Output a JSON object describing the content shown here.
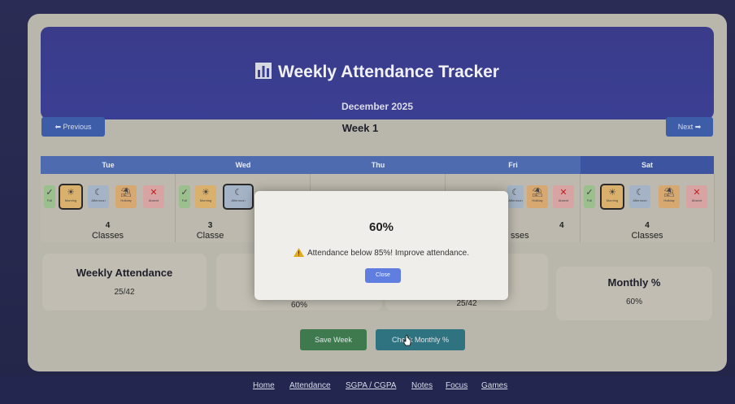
{
  "header": {
    "title": "Weekly Attendance Tracker",
    "month": "December 2025"
  },
  "nav": {
    "previous_label": "⬅ Previous",
    "next_label": "Next ➡",
    "week_label": "Week 1"
  },
  "days": [
    {
      "name": "Tue",
      "classes_count": "4",
      "classes_label": "Classes",
      "selected": "Morning"
    },
    {
      "name": "Wed",
      "classes_count": "3",
      "classes_label": "Classe",
      "selected": "Afternoon"
    },
    {
      "name": "Thu"
    },
    {
      "name": "Fri",
      "classes_count": "4",
      "classes_label": "sses"
    },
    {
      "name": "Sat",
      "classes_count": "4",
      "classes_label": "Classes",
      "selected": "Morning"
    }
  ],
  "chip_labels": {
    "full": "Full",
    "morning": "Morning",
    "afternoon": "Afternoon",
    "holiday": "Holiday",
    "absent": "Absent"
  },
  "stats": [
    {
      "title": "Weekly Attendance",
      "value": "25/42"
    },
    {
      "title": "",
      "value": "60%"
    },
    {
      "title": "",
      "value": "25/42"
    },
    {
      "title": "Monthly %",
      "value": "60%"
    }
  ],
  "actions": {
    "save_label": "Save Week",
    "check_label": "Check Monthly %"
  },
  "modal": {
    "percent": "60%",
    "message": "Attendance below 85%! Improve attendance.",
    "close_label": "Close"
  },
  "footer": {
    "links": [
      "Home",
      "Attendance",
      "SGPA / CGPA",
      "Notes",
      "Focus",
      "Games"
    ]
  },
  "colors": {
    "header": "#3b3f93",
    "nav_button": "#3d5da8",
    "save_button": "#3f7a4e",
    "check_button": "#2f7380",
    "close_button": "#5f7ee0",
    "absent_mark": "#c41d1d"
  }
}
